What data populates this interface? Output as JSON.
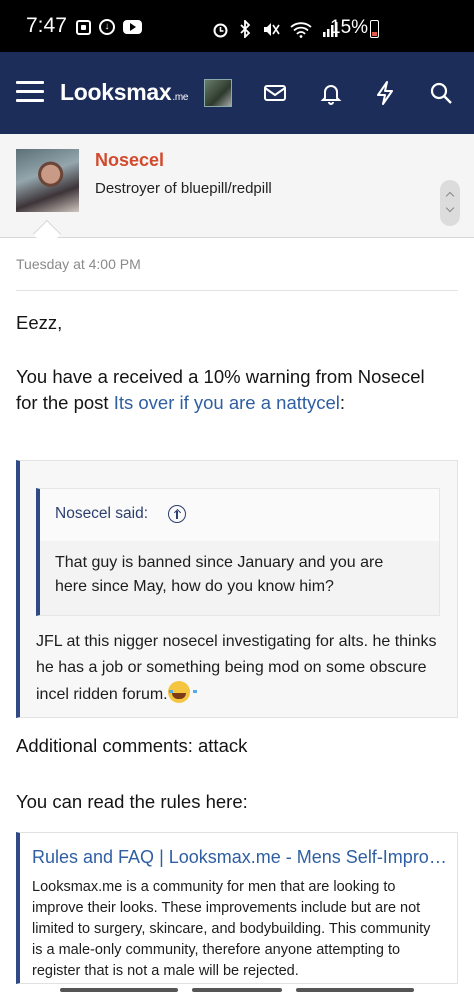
{
  "status_bar": {
    "time": "7:47",
    "battery_percent": "15%",
    "left_icons": [
      "screen-capture-icon",
      "download-icon",
      "youtube-icon"
    ],
    "right_icons": [
      "alarm-icon",
      "bluetooth-icon",
      "mute-icon",
      "wifi-icon",
      "signal-icon",
      "battery-icon"
    ]
  },
  "navbar": {
    "logo_main": "Looksmax",
    "logo_suffix": ".me",
    "icons": [
      "menu-icon",
      "avatar",
      "inbox-icon",
      "alerts-icon",
      "whats-new-icon",
      "search-icon"
    ]
  },
  "conversation": {
    "username": "Nosecel",
    "user_title": "Destroyer of bluepill/redpill"
  },
  "message": {
    "timestamp": "Tuesday at 4:00 PM",
    "greeting": "Eezz,",
    "warning_prefix": "You have a received a 10% warning from Nosecel for the post ",
    "post_link": "Its over if you are a nattycel",
    "warning_suffix": ":",
    "quote": {
      "inner_attribution": "Nosecel said:",
      "inner_text": "That guy is banned since January and you are here since May, how do you know him?",
      "reply_text": "JFL at this nigger nosecel investigating for alts. he thinks he has a job or something being mod on some obscure incel ridden forum."
    },
    "additional_comments": "Additional comments: attack",
    "rules_intro": "You can read the rules here:",
    "unfurl": {
      "title": "Rules and FAQ | Looksmax.me - Mens Self-Improvement & Aesthetics Forum",
      "description": "Looksmax.me is a community for men that are looking to improve their looks. These improvements include but are not limited to surgery, skincare, and bodybuilding. This community is a male-only community, therefore anyone attempting to register that is not a male will be rejected."
    }
  }
}
